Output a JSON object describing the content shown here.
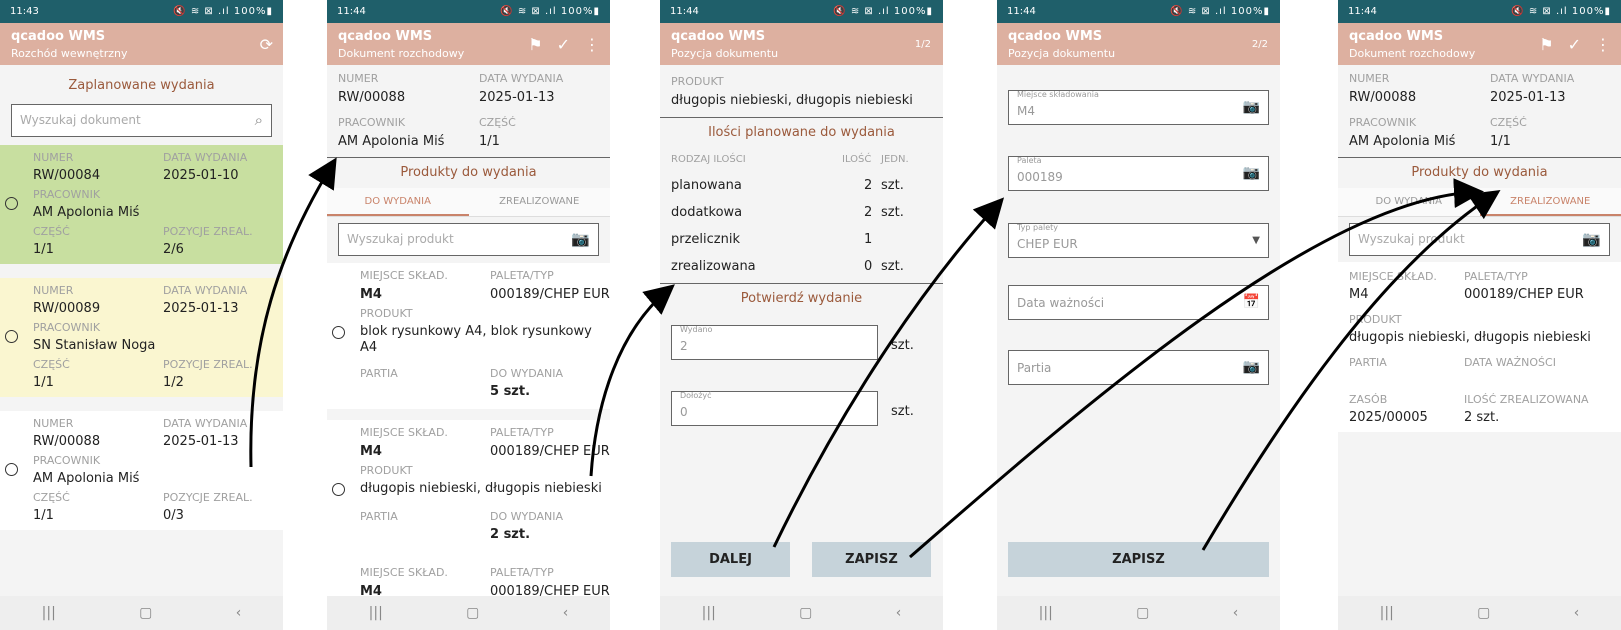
{
  "status": {
    "times": [
      "11:43",
      "11:44",
      "11:44",
      "11:44",
      "11:44"
    ],
    "icons": "🔇 ≋ ⊠ .ıl 100%▮"
  },
  "app_name": "qcadoo WMS",
  "icons": [
    "refresh-icon",
    "flag-icon",
    "check-icon",
    "more-vert-icon",
    "search-icon",
    "camera-icon",
    "calendar-icon",
    "dropdown-arrow-icon",
    "radio-icon"
  ],
  "screen1": {
    "subtitle": "Rozchód wewnętrzny",
    "section_title": "Zaplanowane wydania",
    "search_placeholder": "Wyszukaj dokument",
    "labels": {
      "numer": "NUMER",
      "data": "DATA WYDANIA",
      "pracownik": "PRACOWNIK",
      "czesc": "CZĘŚĆ",
      "pozycje": "POZYCJE ZREAL."
    },
    "documents": [
      {
        "numer": "RW/00084",
        "data": "2025-01-10",
        "pracownik": "AM Apolonia Miś",
        "czesc": "1/1",
        "pozycje": "2/6",
        "color": "#c8dfa0"
      },
      {
        "numer": "RW/00089",
        "data": "2025-01-13",
        "pracownik": "SN Stanisław Noga",
        "czesc": "1/1",
        "pozycje": "1/2",
        "color": "#faf6d0"
      },
      {
        "numer": "RW/00088",
        "data": "2025-01-13",
        "pracownik": "AM Apolonia Miś",
        "czesc": "1/1",
        "pozycje": "0/3",
        "color": "#ffffff"
      }
    ]
  },
  "screen2": {
    "subtitle": "Dokument rozchodowy",
    "header": {
      "numer_label": "NUMER",
      "numer": "RW/00088",
      "data_label": "DATA WYDANIA",
      "data": "2025-01-13",
      "pracownik_label": "PRACOWNIK",
      "pracownik": "AM Apolonia Miś",
      "czesc_label": "CZĘŚĆ",
      "czesc": "1/1"
    },
    "section_title": "Produkty do wydania",
    "tabs": [
      "DO WYDANIA",
      "ZREALIZOWANE"
    ],
    "search_placeholder": "Wyszukaj produkt",
    "labels": {
      "miejsce": "MIEJSCE SKŁAD.",
      "paleta": "PALETA/TYP",
      "produkt": "PRODUKT",
      "partia": "PARTIA",
      "do_wydania": "DO WYDANIA"
    },
    "items": [
      {
        "miejsce": "M4",
        "paleta": "000189/CHEP EUR",
        "produkt": "blok rysunkowy A4, blok rysunkowy A4",
        "do_wydania": "5 szt."
      },
      {
        "miejsce": "M4",
        "paleta": "000189/CHEP EUR",
        "produkt": "długopis niebieski, długopis niebieski",
        "do_wydania": "2 szt."
      },
      {
        "miejsce": "M4",
        "paleta": "000189/CHEP EUR"
      }
    ]
  },
  "screen3": {
    "subtitle": "Pozycja dokumentu",
    "pager": "1/2",
    "produkt_label": "PRODUKT",
    "produkt": "długopis niebieski, długopis niebieski",
    "ilosci_title": "Ilości planowane do wydania",
    "cols": [
      "RODZAJ ILOŚCI",
      "ILOŚĆ",
      "JEDN."
    ],
    "rows": [
      {
        "rodzaj": "planowana",
        "ilosc": "2",
        "jedn": "szt."
      },
      {
        "rodzaj": "dodatkowa",
        "ilosc": "2",
        "jedn": "szt."
      },
      {
        "rodzaj": "przelicznik",
        "ilosc": "1",
        "jedn": ""
      },
      {
        "rodzaj": "zrealizowana",
        "ilosc": "0",
        "jedn": "szt."
      }
    ],
    "confirm_title": "Potwierdź wydanie",
    "wydano_label": "Wydano",
    "wydano_value": "2",
    "dolozyc_label": "Dołożyć",
    "dolozyc_value": "0",
    "unit": "szt.",
    "btn_next": "DALEJ",
    "btn_save": "ZAPISZ"
  },
  "screen4": {
    "subtitle": "Pozycja dokumentu",
    "pager": "2/2",
    "miejsce_label": "Miejsce składowania",
    "miejsce_value": "M4",
    "paleta_label": "Paleta",
    "paleta_value": "000189",
    "typ_label": "Typ palety",
    "typ_value": "CHEP EUR",
    "data_placeholder": "Data ważności",
    "partia_placeholder": "Partia",
    "btn_save": "ZAPISZ"
  },
  "screen5": {
    "subtitle": "Dokument rozchodowy",
    "header": {
      "numer_label": "NUMER",
      "numer": "RW/00088",
      "data_label": "DATA WYDANIA",
      "data": "2025-01-13",
      "pracownik_label": "PRACOWNIK",
      "pracownik": "AM Apolonia Miś",
      "czesc_label": "CZĘŚĆ",
      "czesc": "1/1"
    },
    "section_title": "Produkty do wydania",
    "tabs": [
      "DO WYDANIA",
      "ZREALIZOWANE"
    ],
    "search_placeholder": "Wyszukaj produkt",
    "labels": {
      "miejsce": "MIEJSCE SKŁAD.",
      "paleta": "PALETA/TYP",
      "produkt": "PRODUKT",
      "partia": "PARTIA",
      "data_waznosci": "DATA WAŻNOŚCI",
      "zasob": "ZASÓB",
      "ilosc_zreal": "ILOŚĆ ZREALIZOWANA"
    },
    "item": {
      "miejsce": "M4",
      "paleta": "000189/CHEP EUR",
      "produkt": "długopis niebieski, długopis niebieski",
      "zasob": "2025/00005",
      "ilosc_zreal": "2 szt."
    }
  }
}
